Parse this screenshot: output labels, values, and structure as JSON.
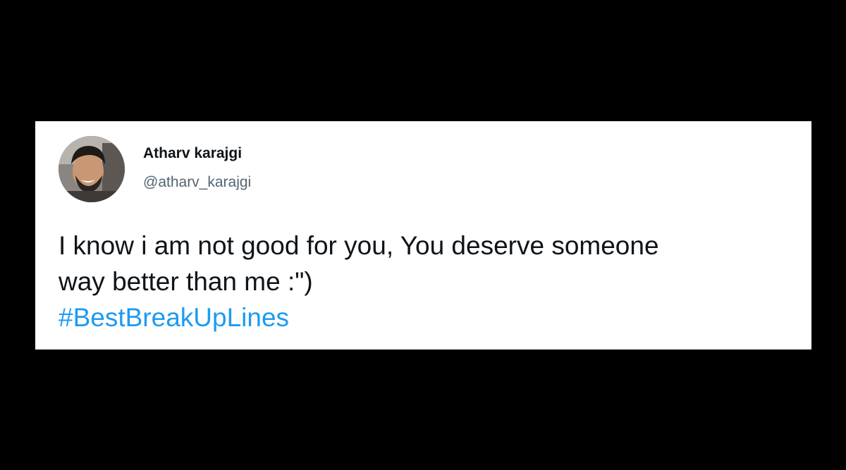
{
  "tweet": {
    "author_name": "Atharv karajgi",
    "author_handle": "@atharv_karajgi",
    "text_lines": [
      "I know i am not good for you, You deserve someone",
      "way better than me :\")"
    ],
    "hashtag": "#BestBreakUpLines"
  },
  "colors": {
    "background": "#000000",
    "card": "#ffffff",
    "text": "#0f1419",
    "handle": "#536471",
    "link": "#1d9bf0"
  },
  "icons": {
    "avatar": "profile-photo"
  }
}
